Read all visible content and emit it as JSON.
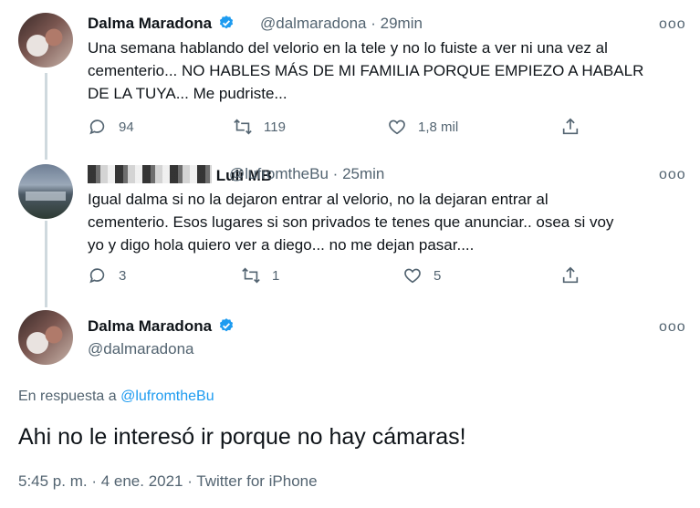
{
  "tweets": [
    {
      "name": "Dalma Maradona",
      "handle": "@dalmaradona",
      "time": "29min",
      "text_lines": [
        "Una semana hablando del velorio en la tele y no lo fuiste a ver ni una vez al",
        "cementerio... NO HABLES MÁS DE MI FAMILIA PORQUE EMPIEZO A HABALR",
        "DE LA TUYA... Me pudriste..."
      ],
      "replies": "94",
      "retweets": "119",
      "likes": "1,8 mil"
    },
    {
      "name": "Luli MB",
      "handle": "@lufromtheBu",
      "time": "25min",
      "text_lines": [
        "Igual dalma si no la dejaron entrar al velorio, no la dejaran entrar al",
        "cementerio. Esos lugares si son privados te tenes que anunciar.. osea si voy",
        "yo y digo hola quiero ver a diego... no me dejan pasar...."
      ],
      "replies": "3",
      "retweets": "1",
      "likes": "5"
    }
  ],
  "main_tweet": {
    "name": "Dalma Maradona",
    "handle": "@dalmaradona",
    "reply_prefix": "En respuesta a",
    "reply_handle": "@lufromtheBu",
    "text": "Ahi no le interesó ir porque no hay cámaras!",
    "meta": "5:45 p. m. · 4 ene. 2021 · Twitter for iPhone"
  },
  "more_glyph": "ooo",
  "separator": "·",
  "colors": {
    "accent": "#1d9bf0",
    "secondary": "#536471",
    "thread": "#cfd9de"
  }
}
